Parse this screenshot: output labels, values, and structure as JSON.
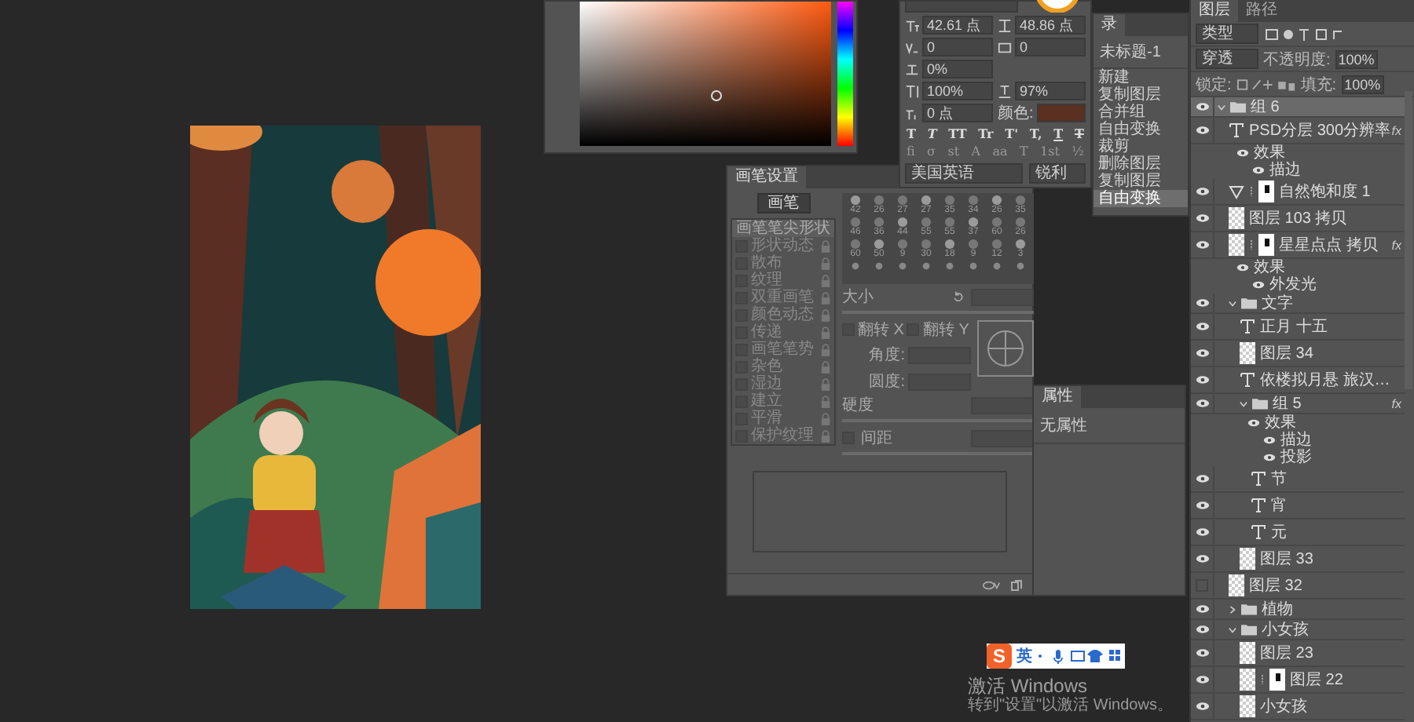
{
  "character": {
    "font_size": "42.61 点",
    "leading": "48.86 点",
    "kerning": "0",
    "tracking": "0",
    "tsume": "0%",
    "vertical_scale": "100%",
    "horizontal_scale": "97%",
    "baseline_shift": "0 点",
    "color_label": "颜色:",
    "color": "#5a3020",
    "style_buttons": [
      {
        "label": "T",
        "kind": "bold"
      },
      {
        "label": "T",
        "kind": "italic"
      },
      {
        "label": "TT",
        "kind": "caps"
      },
      {
        "label": "Tr",
        "kind": "smallcaps"
      },
      {
        "label": "T'",
        "kind": "super"
      },
      {
        "label": "T,",
        "kind": "sub"
      },
      {
        "label": "T",
        "kind": "underline"
      },
      {
        "label": "T",
        "kind": "strike"
      }
    ],
    "opentype_buttons": [
      "fi",
      "σ",
      "st",
      "A",
      "aa",
      "T",
      "1st",
      "½"
    ],
    "language": "美国英语",
    "antialias": "锐利"
  },
  "history": {
    "tab": "录",
    "snapshot": "未标题-1",
    "items": [
      {
        "label": "新建",
        "selected": false
      },
      {
        "label": "复制图层",
        "selected": false
      },
      {
        "label": "合并组",
        "selected": false
      },
      {
        "label": "自由变换",
        "selected": false
      },
      {
        "label": "裁剪",
        "selected": false
      },
      {
        "label": "删除图层",
        "selected": false
      },
      {
        "label": "复制图层",
        "selected": false
      },
      {
        "label": "自由变换",
        "selected": true
      }
    ]
  },
  "brush_settings": {
    "tab": "画笔设置",
    "brush_button": "画笔",
    "tip_shape": "画笔笔尖形状",
    "options": [
      {
        "label": "形状动态",
        "checked": false
      },
      {
        "label": "散布",
        "checked": false
      },
      {
        "label": "纹理",
        "checked": false
      },
      {
        "label": "双重画笔",
        "checked": false
      },
      {
        "label": "颜色动态",
        "checked": false
      },
      {
        "label": "传递",
        "checked": false
      },
      {
        "label": "画笔笔势",
        "checked": false
      },
      {
        "label": "杂色",
        "checked": false
      },
      {
        "label": "湿边",
        "checked": false
      },
      {
        "label": "建立",
        "checked": false
      },
      {
        "label": "平滑",
        "checked": false
      },
      {
        "label": "保护纹理",
        "checked": false
      }
    ],
    "preset_sizes": [
      "42",
      "26",
      "27",
      "27",
      "35",
      "34",
      "26",
      "35",
      "46",
      "36",
      "44",
      "55",
      "55",
      "37",
      "60",
      "26",
      "60",
      "50",
      "9",
      "30",
      "18",
      "9",
      "12",
      "3"
    ],
    "size_label": "大小",
    "flip_x": {
      "label": "翻转 X",
      "checked": false
    },
    "flip_y": {
      "label": "翻转 Y",
      "checked": false
    },
    "angle_label": "角度:",
    "roundness_label": "圆度:",
    "hardness_label": "硬度",
    "spacing": {
      "label": "间距",
      "checked": false
    }
  },
  "properties": {
    "tab": "属性",
    "message": "无属性"
  },
  "layers": {
    "tabs": [
      {
        "label": "图层",
        "selected": true
      },
      {
        "label": "路径",
        "selected": false
      }
    ],
    "filter": "类型",
    "blend_mode": "穿透",
    "opacity_label": "不透明度:",
    "opacity": "100%",
    "lock_label": "锁定:",
    "fill_label": "填充:",
    "fill": "100%",
    "items": [
      {
        "name": "组 6",
        "kind": "group",
        "visible": true,
        "selected": true,
        "expanded": true,
        "children": [
          {
            "name": "PSD分层 300分辨率",
            "kind": "text",
            "visible": true,
            "selected": false,
            "fx": "fx",
            "effects": {
              "label": "效果",
              "items": [
                "描边"
              ]
            }
          },
          {
            "name": "自然饱和度 1",
            "kind": "adjustment",
            "visible": true,
            "selected": false,
            "mask": true
          },
          {
            "name": "图层 103 拷贝",
            "kind": "pixel",
            "visible": true,
            "selected": false
          },
          {
            "name": "星星点点 拷贝",
            "kind": "pixel",
            "visible": true,
            "selected": false,
            "mask": true,
            "fx": "fx",
            "effects": {
              "label": "效果",
              "items": [
                "外发光"
              ]
            }
          },
          {
            "name": "文字",
            "kind": "group",
            "visible": true,
            "selected": false,
            "expanded": true,
            "children": [
              {
                "name": "正月 十五",
                "kind": "text",
                "visible": true,
                "selected": false
              },
              {
                "name": "图层 34",
                "kind": "pixel",
                "visible": true,
                "selected": false
              },
              {
                "name": "依楼拟月悬 旅汉…",
                "kind": "text",
                "visible": true,
                "selected": false
              },
              {
                "name": "组 5",
                "kind": "group",
                "visible": true,
                "selected": false,
                "expanded": true,
                "fx": "fx",
                "effects": {
                  "label": "效果",
                  "items": [
                    "描边",
                    "投影"
                  ]
                },
                "children": [
                  {
                    "name": "节",
                    "kind": "text",
                    "visible": true,
                    "selected": false
                  },
                  {
                    "name": "宵",
                    "kind": "text",
                    "visible": true,
                    "selected": false
                  },
                  {
                    "name": "元",
                    "kind": "text",
                    "visible": true,
                    "selected": false
                  }
                ]
              },
              {
                "name": "图层 33",
                "kind": "pixel",
                "visible": true,
                "selected": false
              }
            ]
          },
          {
            "name": "图层 32",
            "kind": "pixel",
            "visible": false,
            "selected": false
          },
          {
            "name": "植物",
            "kind": "group",
            "visible": true,
            "selected": false,
            "expanded": false
          },
          {
            "name": "小女孩",
            "kind": "group",
            "visible": true,
            "selected": false,
            "expanded": true,
            "children": [
              {
                "name": "图层 23",
                "kind": "pixel",
                "visible": true,
                "selected": false
              },
              {
                "name": "图层 22",
                "kind": "pixel",
                "visible": true,
                "selected": false,
                "mask": true
              },
              {
                "name": "小女孩",
                "kind": "pixel",
                "visible": true,
                "selected": false
              }
            ]
          }
        ]
      }
    ]
  },
  "ime": {
    "logo": "S",
    "mode": "英"
  },
  "activation": {
    "title": "激活 Windows",
    "hint": "转到\"设置\"以激活 Windows。"
  }
}
